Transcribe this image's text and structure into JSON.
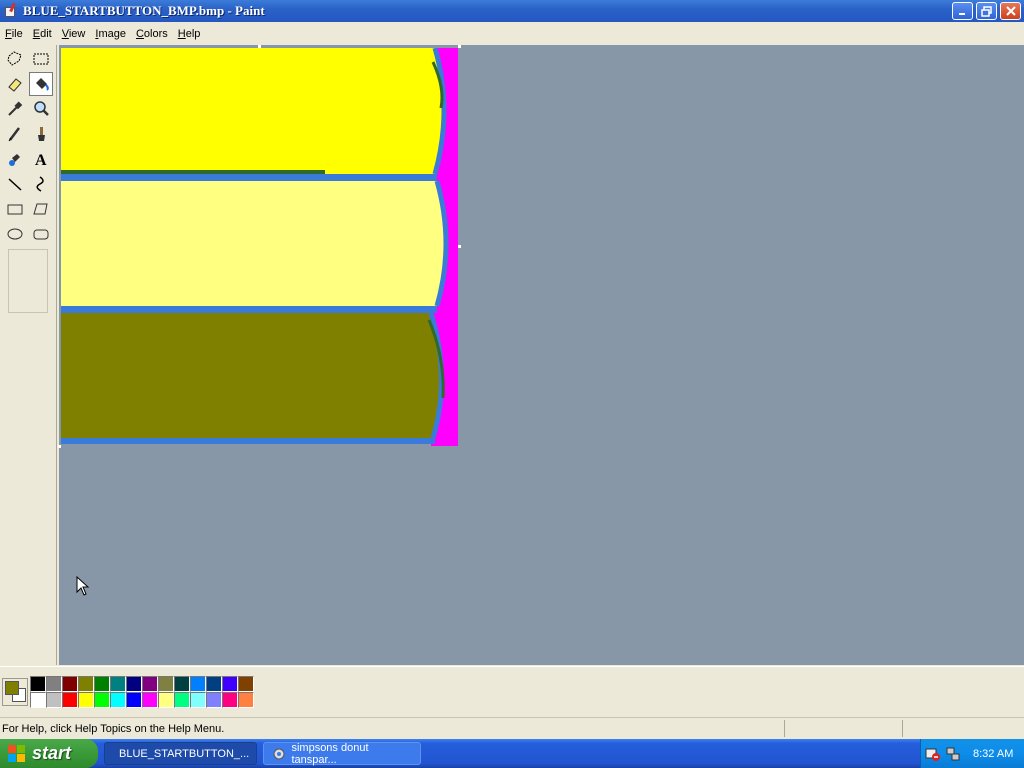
{
  "window": {
    "title": "BLUE_STARTBUTTON_BMP.bmp - Paint",
    "controls": {
      "minimize": "minimize",
      "restore": "restore",
      "close": "close"
    }
  },
  "menu": {
    "items": [
      {
        "label": "File",
        "accel": "F",
        "rest": "ile"
      },
      {
        "label": "Edit",
        "accel": "E",
        "rest": "dit"
      },
      {
        "label": "View",
        "accel": "V",
        "rest": "iew"
      },
      {
        "label": "Image",
        "accel": "I",
        "rest": "mage"
      },
      {
        "label": "Colors",
        "accel": "C",
        "rest": "olors"
      },
      {
        "label": "Help",
        "accel": "H",
        "rest": "elp"
      }
    ]
  },
  "toolbox": {
    "tools": [
      {
        "name": "free-form-select-icon"
      },
      {
        "name": "select-icon"
      },
      {
        "name": "eraser-icon"
      },
      {
        "name": "fill-with-color-icon",
        "selected": true
      },
      {
        "name": "pick-color-icon"
      },
      {
        "name": "magnifier-icon"
      },
      {
        "name": "pencil-icon"
      },
      {
        "name": "brush-icon"
      },
      {
        "name": "airbrush-icon"
      },
      {
        "name": "text-icon",
        "glyph": "A"
      },
      {
        "name": "line-icon"
      },
      {
        "name": "curve-icon"
      },
      {
        "name": "rectangle-icon"
      },
      {
        "name": "polygon-icon"
      },
      {
        "name": "ellipse-icon"
      },
      {
        "name": "rounded-rectangle-icon"
      }
    ]
  },
  "colors": {
    "workspace_bg": "#8897a8",
    "canvas_yellow": "#ffff00",
    "canvas_pale_yellow": "#ffff80",
    "canvas_olive": "#808000",
    "canvas_blue_border": "#3a7ad8",
    "canvas_magenta": "#ff00ff",
    "canvas_dark_green": "#2f6a2a"
  },
  "palette": {
    "foreground": "#808000",
    "background": "#ffffff",
    "row1": [
      "#000000",
      "#808080",
      "#800000",
      "#808000",
      "#008000",
      "#008080",
      "#000080",
      "#800080",
      "#808040",
      "#004040",
      "#0080ff",
      "#004080",
      "#4000ff",
      "#804000"
    ],
    "row2": [
      "#ffffff",
      "#c0c0c0",
      "#ff0000",
      "#ffff00",
      "#00ff00",
      "#00ffff",
      "#0000ff",
      "#ff00ff",
      "#ffff80",
      "#00ff80",
      "#80ffff",
      "#8080ff",
      "#ff0080",
      "#ff8040"
    ]
  },
  "status": {
    "help_text": "For Help, click Help Topics on the Help Menu."
  },
  "taskbar": {
    "start_label": "start",
    "tasks": [
      {
        "label": "BLUE_STARTBUTTON_...",
        "active": true
      },
      {
        "label": "simpsons donut tanspar...",
        "active": false
      }
    ],
    "clock": "8:32 AM"
  }
}
